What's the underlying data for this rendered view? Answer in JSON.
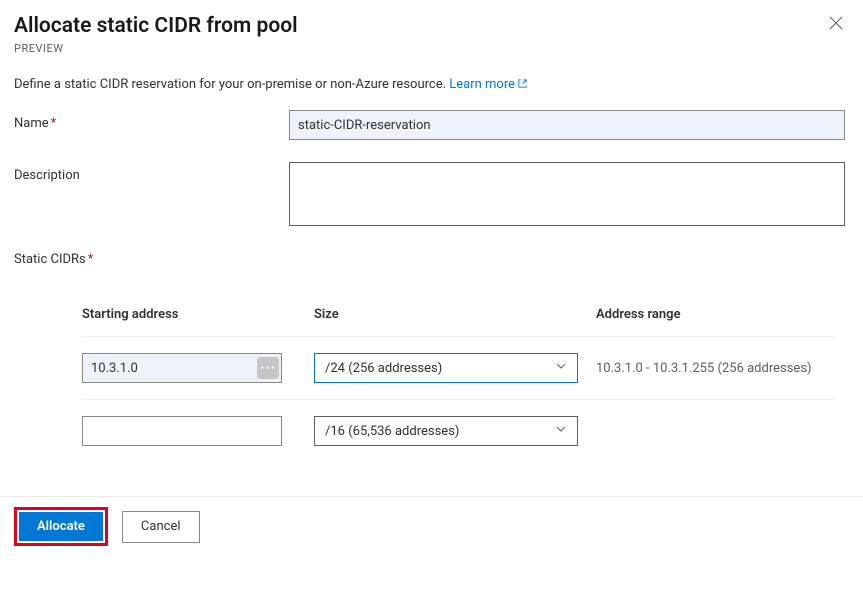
{
  "header": {
    "title": "Allocate static CIDR from pool",
    "badge": "PREVIEW",
    "close_icon": "close"
  },
  "intro": {
    "text": "Define a static CIDR reservation for your on-premise or non-Azure resource. ",
    "link_label": "Learn more"
  },
  "fields": {
    "name": {
      "label": "Name",
      "value": "static-CIDR-reservation"
    },
    "description": {
      "label": "Description",
      "value": ""
    },
    "static_cidrs": {
      "label": "Static CIDRs"
    }
  },
  "table": {
    "headers": {
      "start": "Starting address",
      "size": "Size",
      "range": "Address range"
    },
    "rows": [
      {
        "start": "10.3.1.0",
        "size": "/24 (256 addresses)",
        "range": "10.3.1.0 - 10.3.1.255 (256 addresses)",
        "focused": true,
        "has_ellipsis": true
      },
      {
        "start": "",
        "size": "/16 (65,536 addresses)",
        "range": "",
        "focused": false,
        "has_ellipsis": false
      }
    ]
  },
  "footer": {
    "primary": "Allocate",
    "secondary": "Cancel"
  }
}
